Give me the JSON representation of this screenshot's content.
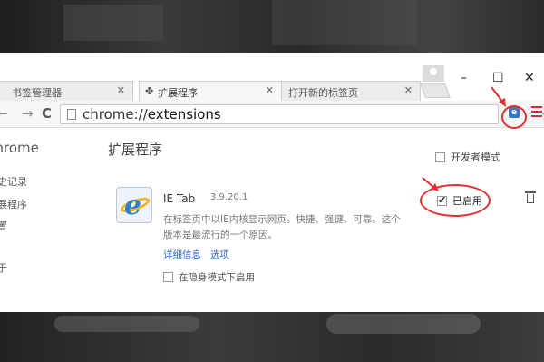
{
  "tabs": [
    {
      "label": "书签管理器"
    },
    {
      "label": "扩展程序"
    },
    {
      "label": "打开新的标签页"
    }
  ],
  "window_controls": {
    "minimize": "–",
    "maximize": "☐",
    "close": "✕"
  },
  "toolbar": {
    "back": "←",
    "forward": "→",
    "reload": "C",
    "url_scheme": "chrome://",
    "url_host": "extensions",
    "star": "☆"
  },
  "sidebar": {
    "title": "Chrome",
    "items": [
      {
        "label": "历史记录"
      },
      {
        "label": "扩展程序"
      },
      {
        "label": "设置"
      },
      {
        "label": "关于"
      }
    ]
  },
  "main": {
    "title": "扩展程序",
    "developer_mode_label": "开发者模式"
  },
  "extension": {
    "name": "IE Tab",
    "version": "3.9.20.1",
    "description": "在标签页中以IE内核显示网页。快捷、强键、可靠。这个版本是最流行的一个原因。",
    "details_link": "详细信息",
    "options_link": "选项",
    "incognito_label": "在隐身模式下启用",
    "enabled_label": "已启用",
    "enabled": true,
    "incognito": false
  },
  "annotation_color": "#e23030"
}
